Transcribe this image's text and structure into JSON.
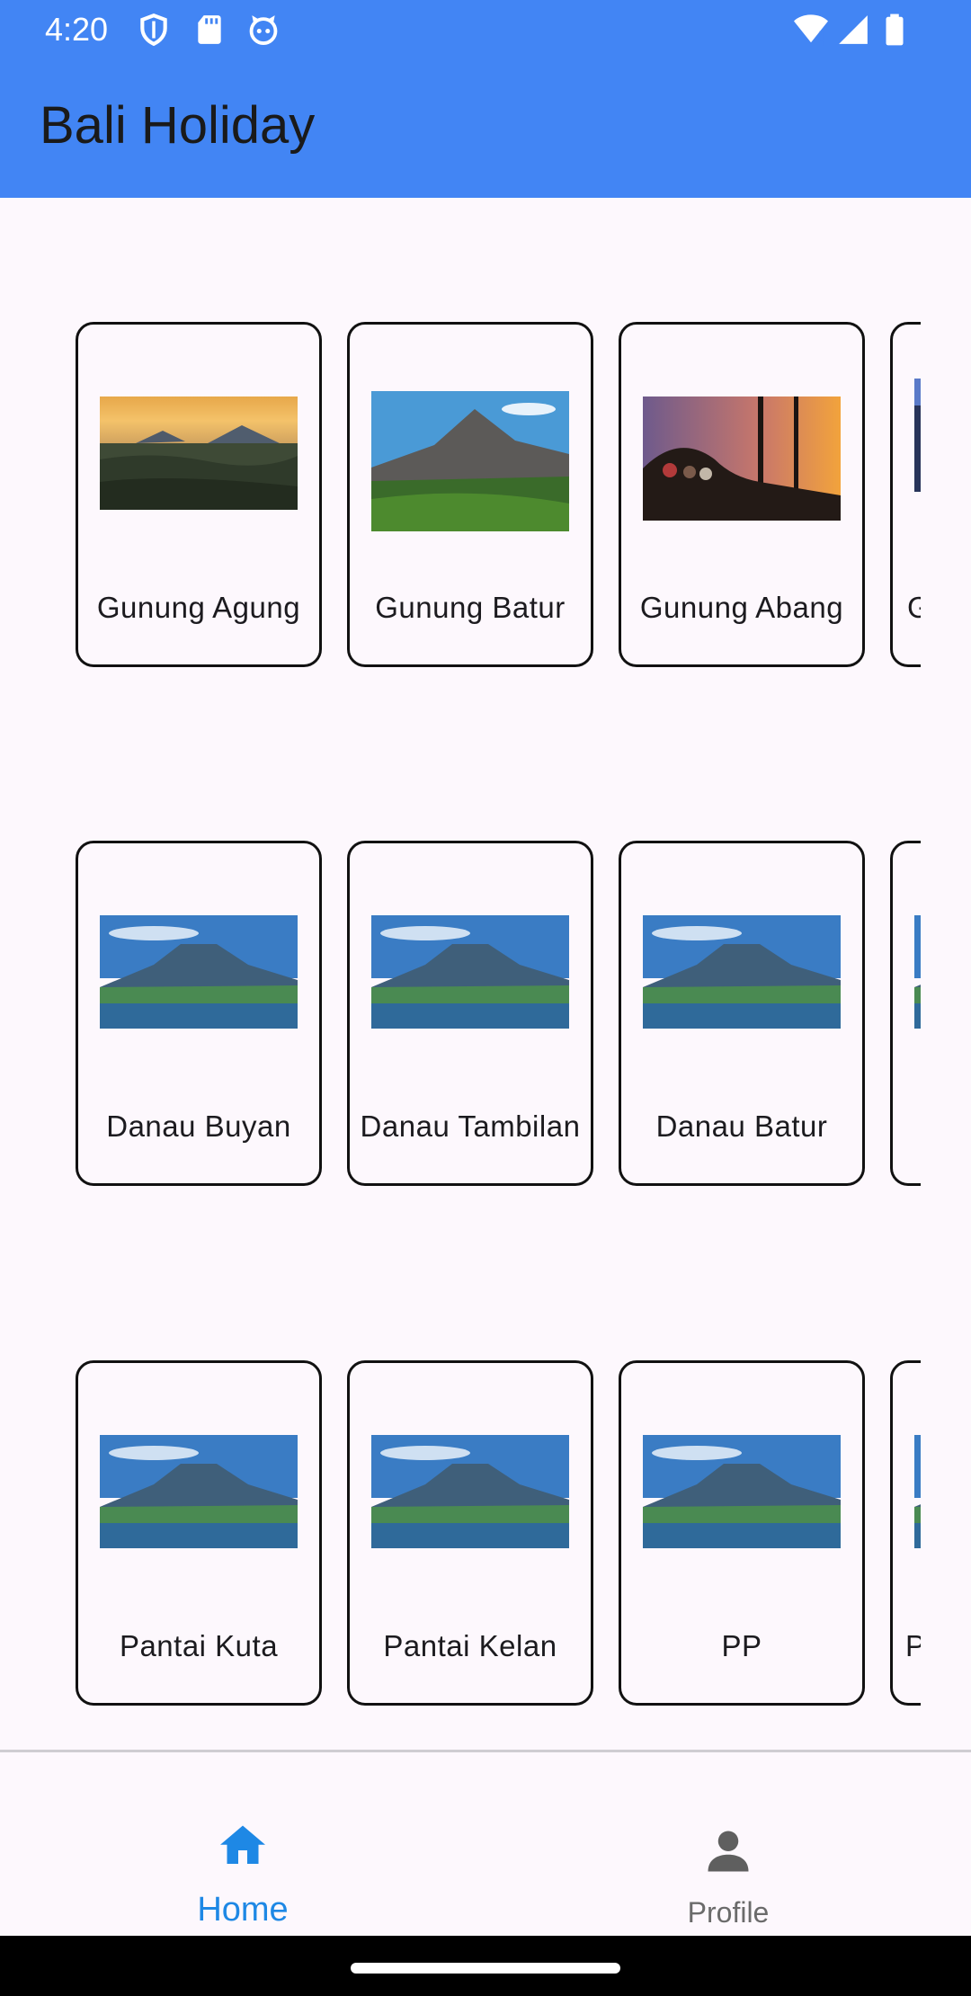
{
  "status_bar": {
    "time": "4:20",
    "left_icons": [
      "shield-icon",
      "sd-card-icon",
      "cat-face-icon"
    ],
    "right_icons": [
      "wifi-icon",
      "signal-icon",
      "battery-icon"
    ]
  },
  "app_bar": {
    "title": "Bali Holiday",
    "color": "#4285f4"
  },
  "rows": [
    {
      "cards": [
        {
          "label": "Gunung Agung",
          "image": "sunset-mountain"
        },
        {
          "label": "Gunung Batur",
          "image": "volcano-day"
        },
        {
          "label": "Gunung Abang",
          "image": "hikers-sunset"
        },
        {
          "label": "G",
          "image": "night-sky"
        }
      ]
    },
    {
      "cards": [
        {
          "label": "Danau Buyan",
          "image": "lake-mountain"
        },
        {
          "label": "Danau Tambilan",
          "image": "lake-mountain"
        },
        {
          "label": "Danau Batur",
          "image": "lake-mountain"
        },
        {
          "label": "",
          "image": "lake-mountain"
        }
      ]
    },
    {
      "cards": [
        {
          "label": "Pantai Kuta",
          "image": "lake-mountain"
        },
        {
          "label": "Pantai Kelan",
          "image": "lake-mountain"
        },
        {
          "label": "PP",
          "image": "lake-mountain"
        },
        {
          "label": "P",
          "image": "lake-mountain"
        }
      ]
    }
  ],
  "bottom_nav": {
    "items": [
      {
        "label": "Home",
        "icon": "home-icon",
        "selected": true,
        "color": "#1e88e5"
      },
      {
        "label": "Profile",
        "icon": "person-icon",
        "selected": false,
        "color": "#6b6b6b"
      }
    ]
  }
}
